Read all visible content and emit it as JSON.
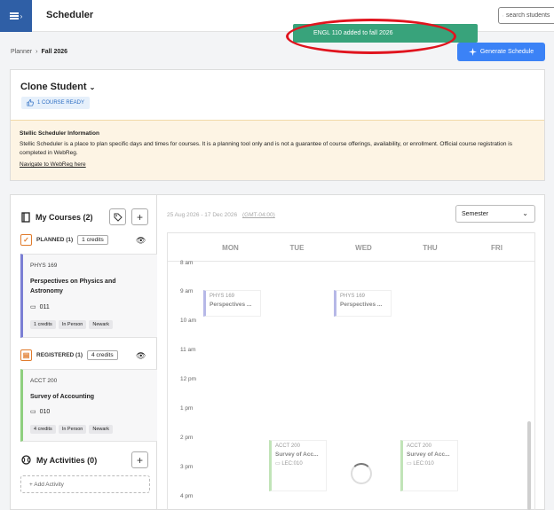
{
  "header": {
    "title": "Scheduler",
    "search_placeholder": "search students"
  },
  "toast": {
    "message": "ENGL 110 added to fall 2026"
  },
  "breadcrumb": {
    "root": "Planner",
    "current": "Fall 2026"
  },
  "generate_button": "Generate Schedule",
  "student": {
    "name": "Clone Student",
    "course_ready": "1 COURSE READY",
    "info_title": "Stellic Scheduler Information",
    "info_body": "Stellic Scheduler is a place to plan specific days and times for courses. It is a planning tool only and is not a guarantee of course offerings, availability, or enrollment. Official course registration is completed in WebReg.",
    "info_link": "Navigate to WebReg here"
  },
  "my_courses": {
    "title": "My Courses (2)",
    "planned": {
      "label": "PLANNED (1)",
      "credits": "1 credits",
      "course": {
        "code": "PHYS 169",
        "title": "Perspectives on Physics and Astronomy",
        "section": "011",
        "tags": [
          "1 credits",
          "In Person",
          "Newark"
        ],
        "color": "#7b7fd4"
      }
    },
    "registered": {
      "label": "REGISTERED (1)",
      "credits": "4 credits",
      "course": {
        "code": "ACCT 200",
        "title": "Survey of Accounting",
        "section": "010",
        "tags": [
          "4 credits",
          "In Person",
          "Newark"
        ],
        "color": "#8fcf7f"
      }
    }
  },
  "my_activities": {
    "title": "My Activities (0)",
    "add_label": "+ Add Activity"
  },
  "calendar": {
    "date_range": "25 Aug 2026 - 17 Dec 2026",
    "timezone": "(GMT-04:00)",
    "view": "Semester",
    "days": [
      "MON",
      "TUE",
      "WED",
      "THU",
      "FRI"
    ],
    "times": [
      "8 am",
      "9 am",
      "10 am",
      "11 am",
      "12 pm",
      "1 pm",
      "2 pm",
      "3 pm",
      "4 pm"
    ],
    "events": [
      {
        "code": "PHYS 169",
        "title": "Perspectives ...",
        "section": "",
        "color": "#7b7fd4"
      },
      {
        "code": "PHYS 169",
        "title": "Perspectives ...",
        "section": "",
        "color": "#7b7fd4"
      },
      {
        "code": "ACCT 200",
        "title": "Survey of Acc...",
        "section": "LEC:010",
        "color": "#8fcf7f"
      },
      {
        "code": "ACCT 200",
        "title": "Survey of Acc...",
        "section": "LEC:010",
        "color": "#8fcf7f"
      }
    ]
  }
}
